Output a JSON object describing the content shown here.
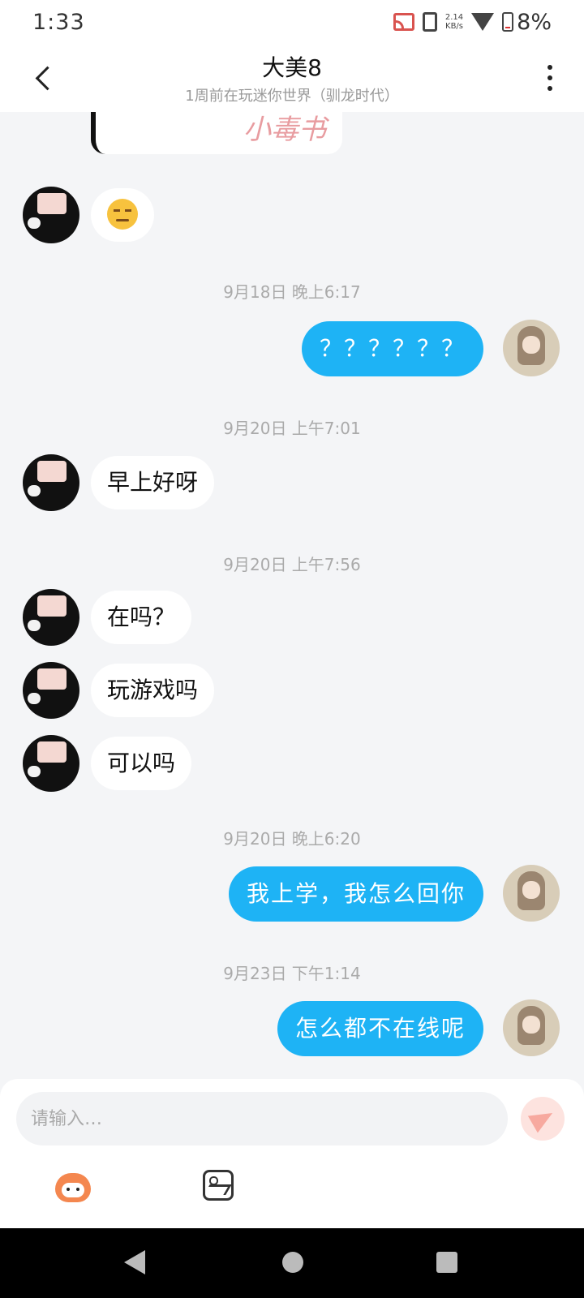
{
  "status_bar": {
    "time": "1:33",
    "net_speed_value": "2.14",
    "net_speed_unit": "KB/s",
    "battery": "8%"
  },
  "header": {
    "title": "大美8",
    "subtitle": "1周前在玩迷你世界（驯龙时代）"
  },
  "previous_image": {
    "scribble_text": "小毒书"
  },
  "messages": [
    {
      "side": "left",
      "emoji": "unamused-face"
    },
    {
      "timestamp": "9月18日 晚上6:17"
    },
    {
      "side": "right",
      "text": "？？？？？？"
    },
    {
      "timestamp": "9月20日 上午7:01"
    },
    {
      "side": "left",
      "text": "早上好呀"
    },
    {
      "timestamp": "9月20日 上午7:56"
    },
    {
      "side": "left",
      "text": "在吗？"
    },
    {
      "side": "left",
      "text": "玩游戏吗"
    },
    {
      "side": "left",
      "text": "可以吗"
    },
    {
      "timestamp": "9月20日 晚上6:20"
    },
    {
      "side": "right",
      "text": "我上学，我怎么回你"
    },
    {
      "timestamp": "9月23日 下午1:14"
    },
    {
      "side": "right",
      "text": "怎么都不在线呢"
    }
  ],
  "input": {
    "placeholder": "请输入…"
  },
  "icons": {
    "back": "back-arrow-icon",
    "more": "more-vertical-icon",
    "send": "send-icon",
    "mascot": "mascot-emoji-icon",
    "image": "image-icon"
  },
  "colors": {
    "sent_bubble": "#1eb3f5",
    "received_bubble": "#ffffff",
    "chat_background": "#f4f5f7",
    "send_button": "#fde3df"
  }
}
